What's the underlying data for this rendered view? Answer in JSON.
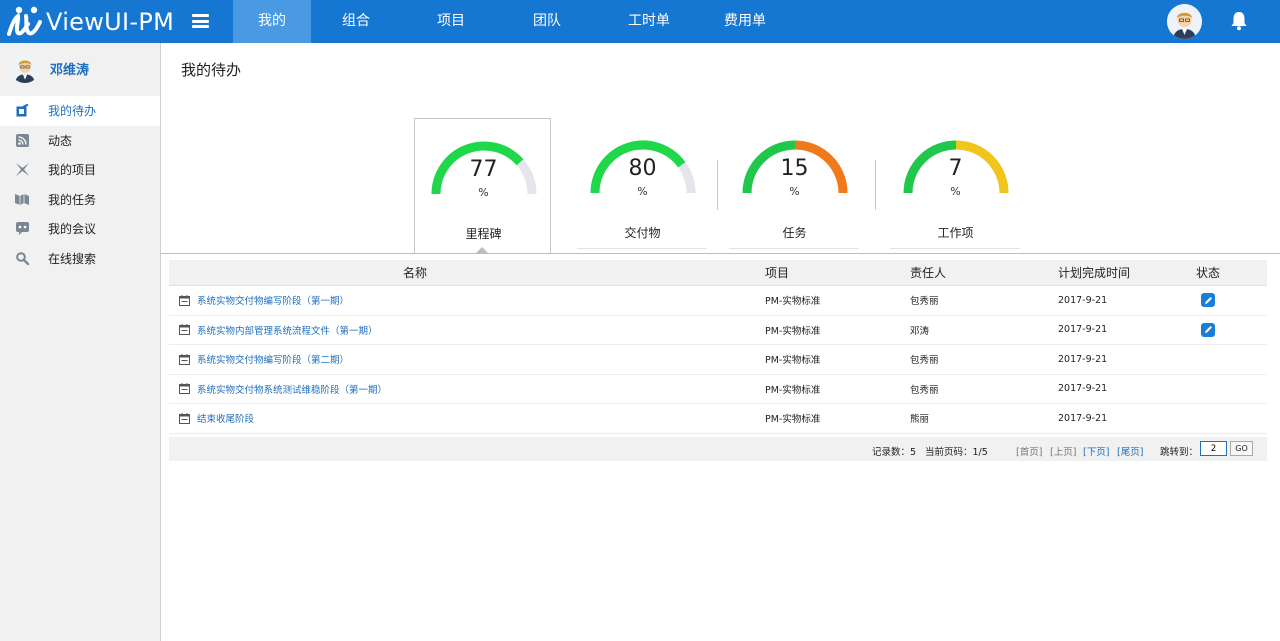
{
  "app": {
    "name": "ViewUI-PM"
  },
  "nav": {
    "items": [
      {
        "label": "我的",
        "active": true
      },
      {
        "label": "组合",
        "active": false
      },
      {
        "label": "项目",
        "active": false
      },
      {
        "label": "团队",
        "active": false
      },
      {
        "label": "工时单",
        "active": false
      },
      {
        "label": "费用单",
        "active": false
      }
    ]
  },
  "user": {
    "name": "邓维涛"
  },
  "sidebar": {
    "items": [
      {
        "label": "我的待办",
        "icon": "todo-icon",
        "active": true
      },
      {
        "label": "动态",
        "icon": "rss-icon",
        "active": false
      },
      {
        "label": "我的项目",
        "icon": "project-icon",
        "active": false
      },
      {
        "label": "我的任务",
        "icon": "task-icon",
        "active": false
      },
      {
        "label": "我的会议",
        "icon": "meeting-icon",
        "active": false
      },
      {
        "label": "在线搜索",
        "icon": "search-icon",
        "active": false
      }
    ]
  },
  "page": {
    "title": "我的待办"
  },
  "gauges": [
    {
      "value": "77",
      "unit": "%",
      "label": "里程碑",
      "percent": 77,
      "color": "#1fd84a",
      "active": true
    },
    {
      "value": "80",
      "unit": "%",
      "label": "交付物",
      "percent": 80,
      "color": "#1fd84a",
      "active": false
    },
    {
      "value": "15",
      "unit": "%",
      "label": "任务",
      "percent": 15,
      "color": "#f07a1a",
      "active": false
    },
    {
      "value": "7",
      "unit": "%",
      "label": "工作项",
      "percent": 7,
      "color": "#f2c51a",
      "active": false
    }
  ],
  "table": {
    "headers": {
      "name": "名称",
      "project": "项目",
      "owner": "责任人",
      "due": "计划完成时间",
      "status": "状态"
    },
    "rows": [
      {
        "name": "系统实物交付物编写阶段（第一期）",
        "project": "PM-实物标准",
        "owner": "包秀丽",
        "due": "2017-9-21",
        "editable": true
      },
      {
        "name": "系统实物内部管理系统流程文件（第一期）",
        "project": "PM-实物标准",
        "owner": "邓涛",
        "due": "2017-9-21",
        "editable": true
      },
      {
        "name": "系统实物交付物编写阶段（第二期）",
        "project": "PM-实物标准",
        "owner": "包秀丽",
        "due": "2017-9-21",
        "editable": false
      },
      {
        "name": "系统实物交付物系统测试维稳阶段（第一期）",
        "project": "PM-实物标准",
        "owner": "包秀丽",
        "due": "2017-9-21",
        "editable": false
      },
      {
        "name": "结束收尾阶段",
        "project": "PM-实物标准",
        "owner": "熊丽",
        "due": "2017-9-21",
        "editable": false
      }
    ]
  },
  "pager": {
    "records": "记录数：5",
    "current": "当前页码：1/5",
    "first": "[首页]",
    "prev": "[上页]",
    "next": "[下页]",
    "last": "[尾页]",
    "jump_label": "跳转到：",
    "jump_value": "2",
    "go": "GO"
  }
}
